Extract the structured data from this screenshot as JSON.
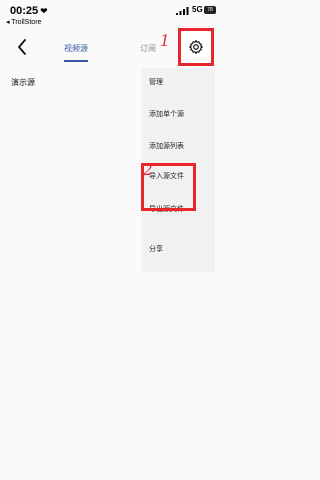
{
  "status_bar": {
    "time": "00:25",
    "back_app": "◂ TrollStore",
    "network": "5G",
    "battery": "78"
  },
  "nav": {
    "tabs": [
      {
        "label": "视频源"
      },
      {
        "label": "订阅"
      }
    ]
  },
  "content": {
    "source_label": "演示源"
  },
  "menu": {
    "items": [
      {
        "label": "管理"
      },
      {
        "label": "添加单个源"
      },
      {
        "label": "添加源列表"
      },
      {
        "label": "导入源文件"
      },
      {
        "label": "导出源文件"
      },
      {
        "label": "分享"
      }
    ]
  },
  "annotations": {
    "step1": "1",
    "step2": "2"
  },
  "colors": {
    "accent": "#3a5aa0",
    "annotation": "#e8262b"
  }
}
